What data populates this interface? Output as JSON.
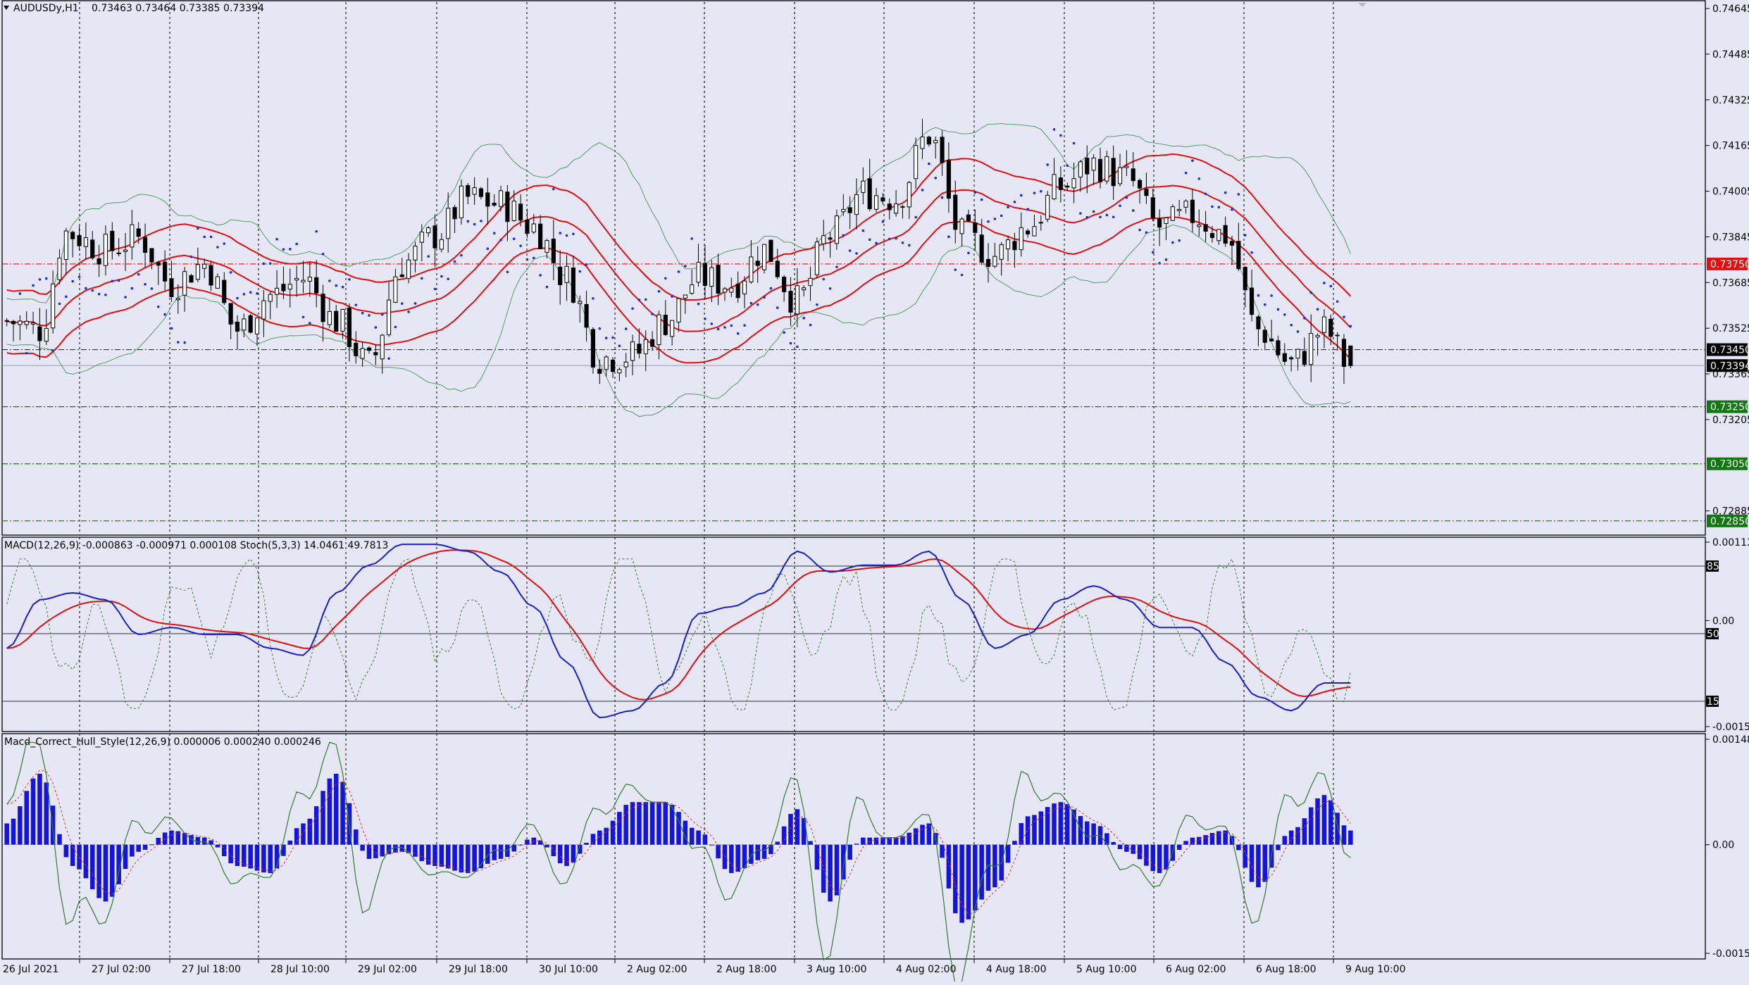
{
  "symbol": "AUDUSDy,H1",
  "ohlc_text": "0.73463 0.73464 0.73385 0.73394",
  "colors": {
    "background": "#e6e6f5",
    "band_outer": "#4f9f68",
    "band_mid": "#e01010",
    "sar": "#1a2ee0",
    "macd_main": "#1a20c8",
    "macd_signal": "#e01010",
    "stoch": "#3a7a3a",
    "hull_hist": "#1515d8",
    "hull_line": "#2f7d2f",
    "hull_signal": "#e03030",
    "level_red": "#e01010",
    "level_green": "#117711"
  },
  "chart_data": [
    {
      "type": "candlestick",
      "title": "AUDUSDy,H1",
      "y_axis_labels": [
        "0.74645",
        "0.74485",
        "0.74325",
        "0.74165",
        "0.74005",
        "0.73845",
        "0.73685",
        "0.73525",
        "0.73365",
        "0.73205",
        "0.72885"
      ],
      "ylim": [
        0.7282,
        0.7465
      ],
      "time_labels": [
        "26 Jul 2021",
        "27 Jul 02:00",
        "27 Jul 18:00",
        "28 Jul 10:00",
        "29 Jul 02:00",
        "29 Jul 18:00",
        "30 Jul 10:00",
        "2 Aug 02:00",
        "2 Aug 18:00",
        "3 Aug 10:00",
        "4 Aug 02:00",
        "4 Aug 18:00",
        "5 Aug 10:00",
        "6 Aug 02:00",
        "6 Aug 18:00",
        "9 Aug 10:00"
      ],
      "close_anchors": [
        {
          "t": 0,
          "y": 0.7355
        },
        {
          "t": 5,
          "y": 0.7352
        },
        {
          "t": 9,
          "y": 0.7386
        },
        {
          "t": 15,
          "y": 0.738
        },
        {
          "t": 20,
          "y": 0.7384
        },
        {
          "t": 25,
          "y": 0.7368
        },
        {
          "t": 30,
          "y": 0.7375
        },
        {
          "t": 35,
          "y": 0.7352
        },
        {
          "t": 40,
          "y": 0.7364
        },
        {
          "t": 45,
          "y": 0.737
        },
        {
          "t": 50,
          "y": 0.7355
        },
        {
          "t": 55,
          "y": 0.734
        },
        {
          "t": 60,
          "y": 0.7375
        },
        {
          "t": 65,
          "y": 0.7385
        },
        {
          "t": 70,
          "y": 0.7398
        },
        {
          "t": 75,
          "y": 0.7396
        },
        {
          "t": 80,
          "y": 0.7388
        },
        {
          "t": 85,
          "y": 0.737
        },
        {
          "t": 90,
          "y": 0.7342
        },
        {
          "t": 95,
          "y": 0.7343
        },
        {
          "t": 100,
          "y": 0.7355
        },
        {
          "t": 105,
          "y": 0.737
        },
        {
          "t": 110,
          "y": 0.7368
        },
        {
          "t": 115,
          "y": 0.738
        },
        {
          "t": 120,
          "y": 0.7362
        },
        {
          "t": 125,
          "y": 0.7385
        },
        {
          "t": 130,
          "y": 0.74
        },
        {
          "t": 135,
          "y": 0.7398
        },
        {
          "t": 140,
          "y": 0.742
        },
        {
          "t": 145,
          "y": 0.7385
        },
        {
          "t": 150,
          "y": 0.7378
        },
        {
          "t": 155,
          "y": 0.7388
        },
        {
          "t": 160,
          "y": 0.7402
        },
        {
          "t": 165,
          "y": 0.741
        },
        {
          "t": 170,
          "y": 0.7405
        },
        {
          "t": 175,
          "y": 0.7388
        },
        {
          "t": 180,
          "y": 0.7392
        },
        {
          "t": 185,
          "y": 0.7385
        },
        {
          "t": 190,
          "y": 0.7352
        },
        {
          "t": 195,
          "y": 0.734
        },
        {
          "t": 200,
          "y": 0.7352
        },
        {
          "t": 204,
          "y": 0.7339
        }
      ],
      "price_levels": [
        {
          "value": "0.73750",
          "color": "red",
          "style": "dash-dot"
        },
        {
          "value": "0.73450",
          "color": "black",
          "style": "dash-dot"
        },
        {
          "value": "0.73394",
          "color": "black",
          "style": "solid"
        },
        {
          "value": "0.73250",
          "color": "green",
          "style": "dash-dot"
        },
        {
          "value": "0.73050",
          "color": "green",
          "style": "dash-dot"
        },
        {
          "value": "0.72850",
          "color": "green",
          "style": "dash-dot"
        }
      ],
      "overlays": [
        "Bollinger bands",
        "Envelope",
        "Parabolic SAR"
      ]
    },
    {
      "type": "line",
      "title": "MACD(12,26,9) -0.000863 -0.000971 0.000108 Stoch(5,3,3) 14.0461 49.7813",
      "y_axis_labels": [
        "0.001132",
        "0.00",
        "-0.00153"
      ],
      "levels": [
        "85",
        "50",
        "15"
      ],
      "ylim": [
        -0.00153,
        0.001132
      ],
      "macd_anchors": [
        {
          "t": 0,
          "y": -0.0004
        },
        {
          "t": 5,
          "y": 0.0003
        },
        {
          "t": 10,
          "y": 0.0004
        },
        {
          "t": 15,
          "y": 0.0003
        },
        {
          "t": 20,
          "y": -0.0002
        },
        {
          "t": 25,
          "y": -0.0001
        },
        {
          "t": 30,
          "y": -0.0002
        },
        {
          "t": 35,
          "y": -0.0002
        },
        {
          "t": 40,
          "y": -0.0004
        },
        {
          "t": 45,
          "y": -0.0005
        },
        {
          "t": 50,
          "y": 0.0004
        },
        {
          "t": 55,
          "y": 0.0008
        },
        {
          "t": 60,
          "y": 0.0011
        },
        {
          "t": 65,
          "y": 0.0011
        },
        {
          "t": 70,
          "y": 0.001
        },
        {
          "t": 75,
          "y": 0.0007
        },
        {
          "t": 80,
          "y": 0.0002
        },
        {
          "t": 85,
          "y": -0.0006
        },
        {
          "t": 90,
          "y": -0.0014
        },
        {
          "t": 95,
          "y": -0.0013
        },
        {
          "t": 100,
          "y": -0.0009
        },
        {
          "t": 105,
          "y": 0.0001
        },
        {
          "t": 110,
          "y": 0.0002
        },
        {
          "t": 115,
          "y": 0.0004
        },
        {
          "t": 120,
          "y": 0.001
        },
        {
          "t": 125,
          "y": 0.0007
        },
        {
          "t": 130,
          "y": 0.0008
        },
        {
          "t": 135,
          "y": 0.0008
        },
        {
          "t": 140,
          "y": 0.001
        },
        {
          "t": 145,
          "y": 0.0003
        },
        {
          "t": 150,
          "y": -0.0004
        },
        {
          "t": 155,
          "y": -0.0002
        },
        {
          "t": 160,
          "y": 0.0003
        },
        {
          "t": 165,
          "y": 0.0005
        },
        {
          "t": 170,
          "y": 0.0003
        },
        {
          "t": 175,
          "y": -0.0001
        },
        {
          "t": 180,
          "y": -0.0001
        },
        {
          "t": 185,
          "y": -0.0006
        },
        {
          "t": 190,
          "y": -0.0011
        },
        {
          "t": 195,
          "y": -0.0013
        },
        {
          "t": 200,
          "y": -0.0009
        },
        {
          "t": 204,
          "y": -0.0009
        }
      ]
    },
    {
      "type": "bar",
      "title": "Macd_Correct_Hull_Style(12,26,9) 0.000006 0.000240 0.000246",
      "y_axis_labels": [
        "0.001485",
        "0.00",
        "-0.00153"
      ],
      "ylim": [
        -0.00153,
        0.001485
      ],
      "hist_anchors": [
        {
          "t": 0,
          "y": 0.0003
        },
        {
          "t": 5,
          "y": 0.001
        },
        {
          "t": 10,
          "y": -0.0003
        },
        {
          "t": 15,
          "y": -0.0008
        },
        {
          "t": 20,
          "y": -0.0001
        },
        {
          "t": 25,
          "y": 0.0002
        },
        {
          "t": 30,
          "y": 0.0001
        },
        {
          "t": 35,
          "y": -0.0003
        },
        {
          "t": 40,
          "y": -0.0004
        },
        {
          "t": 45,
          "y": 0.0003
        },
        {
          "t": 50,
          "y": 0.001
        },
        {
          "t": 55,
          "y": -0.0002
        },
        {
          "t": 60,
          "y": -0.0001
        },
        {
          "t": 65,
          "y": -0.0003
        },
        {
          "t": 70,
          "y": -0.0004
        },
        {
          "t": 75,
          "y": -0.0002
        },
        {
          "t": 80,
          "y": 0.0001
        },
        {
          "t": 85,
          "y": -0.0003
        },
        {
          "t": 90,
          "y": 0.0002
        },
        {
          "t": 95,
          "y": 0.0006
        },
        {
          "t": 100,
          "y": 0.0006
        },
        {
          "t": 105,
          "y": 0.0002
        },
        {
          "t": 110,
          "y": -0.0004
        },
        {
          "t": 115,
          "y": -0.0002
        },
        {
          "t": 120,
          "y": 0.0005
        },
        {
          "t": 125,
          "y": -0.0008
        },
        {
          "t": 130,
          "y": 0.0001
        },
        {
          "t": 135,
          "y": 0.0001
        },
        {
          "t": 140,
          "y": 0.0003
        },
        {
          "t": 145,
          "y": -0.0011
        },
        {
          "t": 150,
          "y": -0.0006
        },
        {
          "t": 155,
          "y": 0.0004
        },
        {
          "t": 160,
          "y": 0.0006
        },
        {
          "t": 165,
          "y": 0.0003
        },
        {
          "t": 170,
          "y": -0.0001
        },
        {
          "t": 175,
          "y": -0.0004
        },
        {
          "t": 180,
          "y": 0.0001
        },
        {
          "t": 185,
          "y": 0.0002
        },
        {
          "t": 190,
          "y": -0.0006
        },
        {
          "t": 195,
          "y": 0.0002
        },
        {
          "t": 200,
          "y": 0.0007
        },
        {
          "t": 204,
          "y": 0.0002
        }
      ]
    }
  ]
}
